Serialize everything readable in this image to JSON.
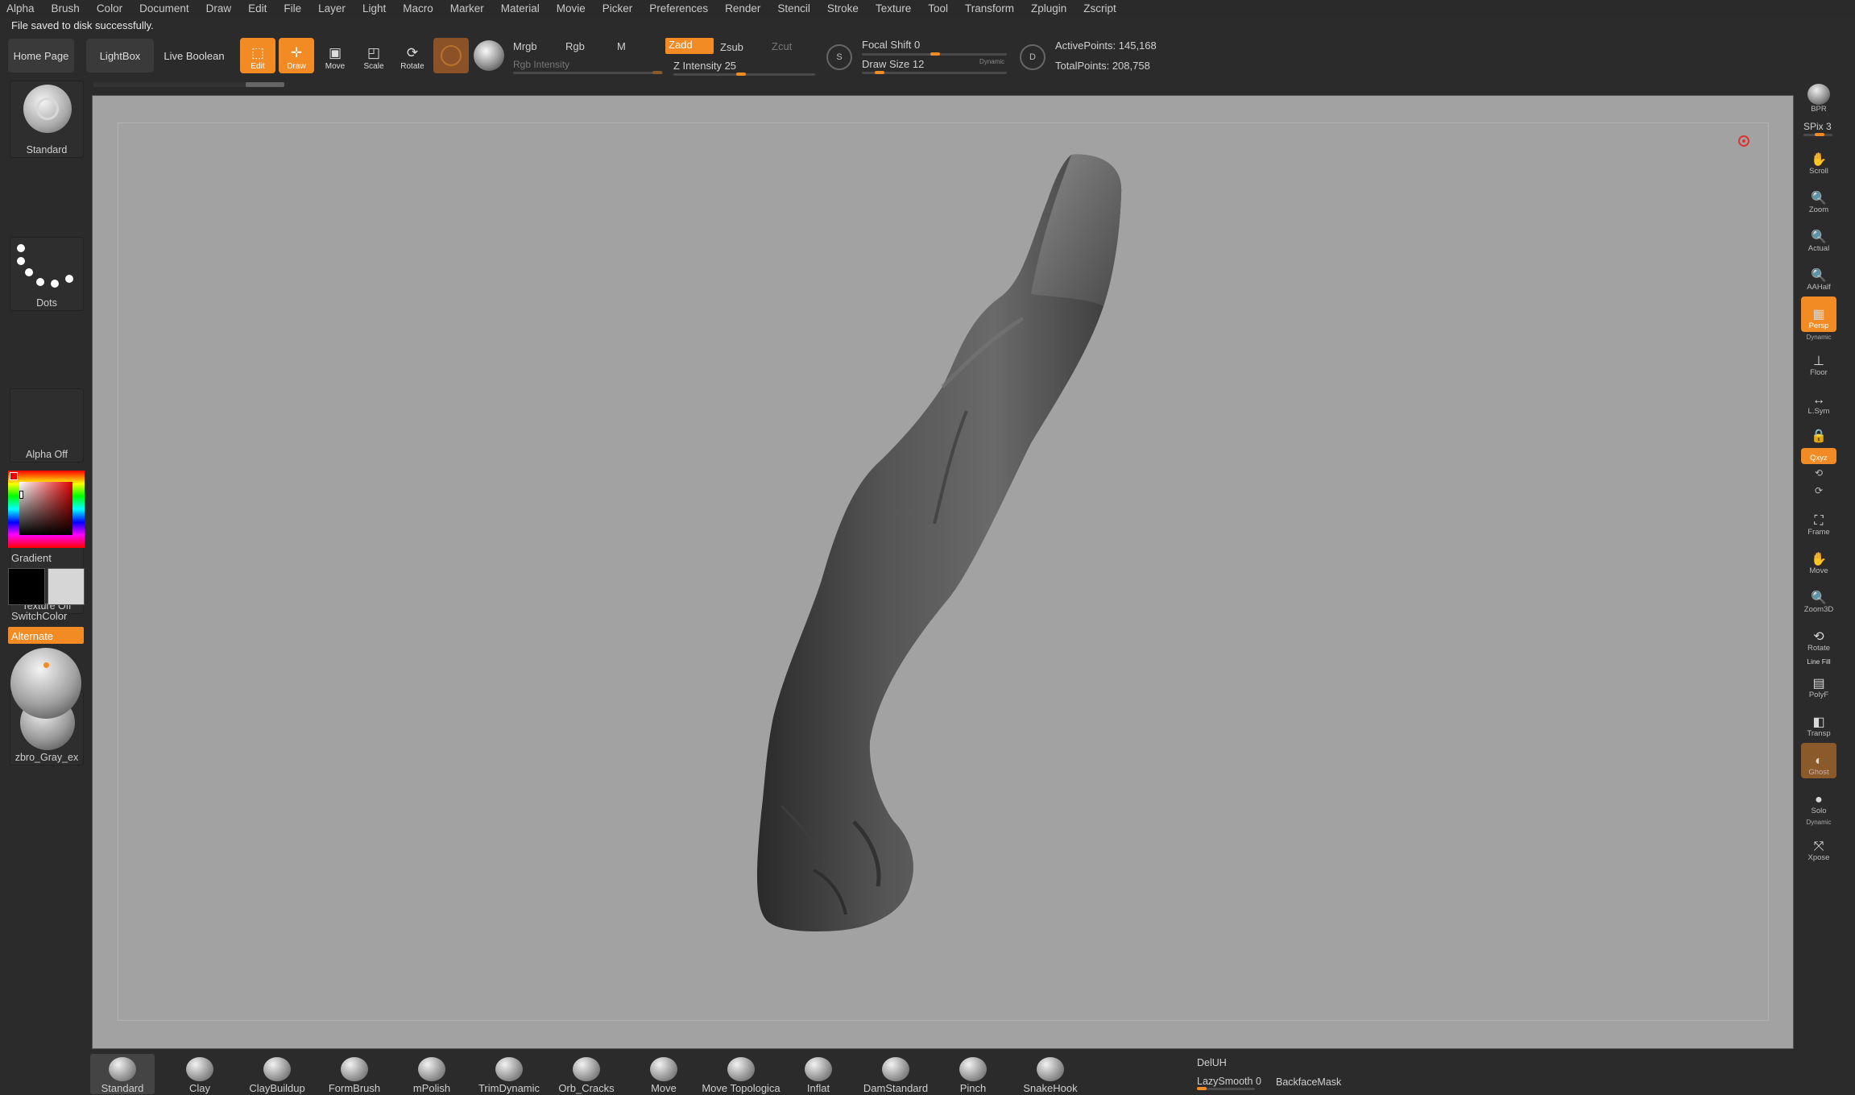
{
  "menu": [
    "Alpha",
    "Brush",
    "Color",
    "Document",
    "Draw",
    "Edit",
    "File",
    "Layer",
    "Light",
    "Macro",
    "Marker",
    "Material",
    "Movie",
    "Picker",
    "Preferences",
    "Render",
    "Stencil",
    "Stroke",
    "Texture",
    "Tool",
    "Transform",
    "Zplugin",
    "Zscript"
  ],
  "notice": "File saved to disk successfully.",
  "top": {
    "home_page": "Home Page",
    "lightbox": "LightBox",
    "live_boolean": "Live Boolean",
    "edit": "Edit",
    "draw": "Draw",
    "move": "Move",
    "scale": "Scale",
    "rotate": "Rotate",
    "mrgb": "Mrgb",
    "rgb": "Rgb",
    "m": "M",
    "zadd": "Zadd",
    "zsub": "Zsub",
    "zcut": "Zcut",
    "rgb_intensity": "Rgb Intensity",
    "z_intensity": "Z Intensity 25",
    "focal_shift": "Focal Shift 0",
    "draw_size": "Draw Size 12",
    "dynamic": "Dynamic",
    "active_points": "ActivePoints: 145,168",
    "total_points": "TotalPoints: 208,758"
  },
  "left": {
    "brush": "Standard",
    "stroke": "Dots",
    "alpha": "Alpha Off",
    "texture": "Texture Off",
    "material": "zbro_Gray_ex",
    "gradient": "Gradient",
    "switch_color": "SwitchColor",
    "alternate": "Alternate"
  },
  "right": {
    "bpr": "BPR",
    "spix": "SPix 3",
    "buttons": [
      {
        "label": "Scroll",
        "icon": "hand-icon"
      },
      {
        "label": "Zoom",
        "icon": "magnifier-icon"
      },
      {
        "label": "Actual",
        "icon": "magnifier-icon"
      },
      {
        "label": "AAHalf",
        "icon": "magnifier-icon"
      },
      {
        "label": "Persp",
        "icon": "perspective-icon",
        "dynamic": "Dynamic"
      },
      {
        "label": "Floor",
        "icon": "floor-icon"
      },
      {
        "label": "L.Sym",
        "icon": "symmetry-icon"
      },
      {
        "label": "",
        "icon": "lock-icon"
      },
      {
        "label": "Qxyz",
        "icon": "axis-icon"
      },
      {
        "label": "Frame",
        "icon": "frame-icon"
      },
      {
        "label": "Move",
        "icon": "hand-icon"
      },
      {
        "label": "Zoom3D",
        "icon": "magnifier-icon"
      },
      {
        "label": "Rotate",
        "icon": "rotate-icon"
      },
      {
        "label": "PolyF",
        "icon": "polyframe-icon",
        "header": "Line Fill"
      },
      {
        "label": "Transp",
        "icon": "transparency-icon"
      },
      {
        "label": "Ghost",
        "icon": "ghost-icon"
      },
      {
        "label": "Solo",
        "icon": "solo-icon",
        "dynamic": "Dynamic"
      },
      {
        "label": "Xpose",
        "icon": "xpose-icon"
      }
    ]
  },
  "bottom": {
    "brushes": [
      "Standard",
      "Clay",
      "ClayBuildup",
      "FormBrush",
      "mPolish",
      "TrimDynamic",
      "Orb_Cracks",
      "Move",
      "Move Topologica",
      "Inflat",
      "DamStandard",
      "Pinch",
      "SnakeHook"
    ],
    "del_uh": "DelUH",
    "lazy_smooth": "LazySmooth 0",
    "backface_mask": "BackfaceMask"
  },
  "colors": {
    "accent": "#f28b24",
    "canvas": "#a2a2a2",
    "ui": "#2b2b2b"
  }
}
